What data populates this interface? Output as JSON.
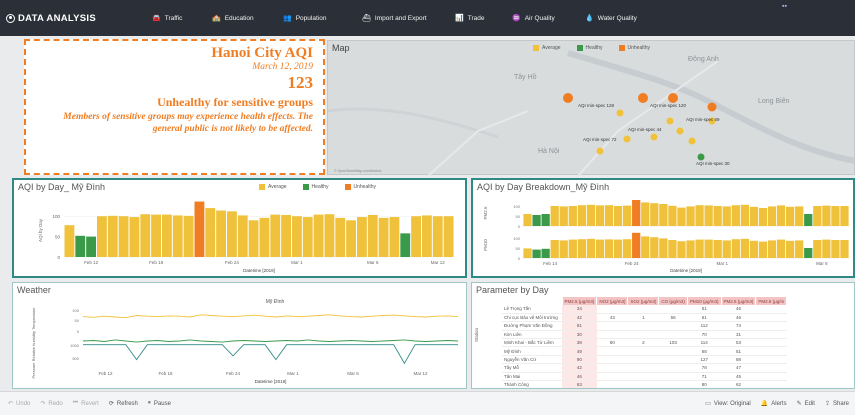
{
  "brand": "DATA ANALYSIS",
  "nav": [
    {
      "label": "Traffic",
      "icon": "car-icon",
      "glyph": "🚘"
    },
    {
      "label": "Education",
      "icon": "school-icon",
      "glyph": "🏫"
    },
    {
      "label": "Population",
      "icon": "people-icon",
      "glyph": "👥"
    },
    {
      "label": "Import and Export",
      "icon": "ship-icon",
      "glyph": "⛴"
    },
    {
      "label": "Trade",
      "icon": "chart-icon",
      "glyph": "📊"
    },
    {
      "label": "Air Quality",
      "icon": "air-icon",
      "glyph": "♒"
    },
    {
      "label": "Water Quality",
      "icon": "water-icon",
      "glyph": "💧"
    }
  ],
  "top_dots": "▪▪",
  "aqi": {
    "city": "Hanoi City AQI",
    "date": "March 12, 2019",
    "value": "123",
    "category": "Unhealthy for sensitive groups",
    "description": "Members of sensitive groups may experience health effects. The general public is not likely to be affected."
  },
  "legend": {
    "average": "Average",
    "healthy": "Healthy",
    "unhealthy": "Unhealthy"
  },
  "colors": {
    "average": "#f0c23b",
    "healthy": "#3a9a4a",
    "unhealthy": "#f07d22",
    "teal": "#2f8a86"
  },
  "map": {
    "title": "Map",
    "places": [
      "Tây Hồ",
      "Long Biên",
      "Đông Anh",
      "Hà Nội"
    ],
    "labels": [
      "AQI min-spec 128",
      "AQI min-spec 120",
      "AQI min-spec 44",
      "AQI min-spec 69",
      "AQI min-spec 72",
      "AQI min-spec 30"
    ],
    "credit": "© OpenStreetMap contributors"
  },
  "aqi_by_day": {
    "title": "AQI by Day",
    "station": "Mỹ Đình",
    "ylabel": "AQI by Day",
    "xlabel": "Datetime [2019]",
    "yticks": [
      "100",
      "50",
      "0"
    ],
    "xticks": [
      "Feb 12",
      "Feb 18",
      "Feb 24",
      "Mar 1",
      "Mar 6",
      "Mar 12"
    ]
  },
  "breakdown": {
    "title": "AQI by Day Breakdown",
    "station": "Mỹ Đình",
    "rows": [
      "PM2.5",
      "PM10"
    ],
    "yticks": [
      "100",
      "50",
      "0"
    ],
    "xticks": [
      "Feb 14",
      "Feb 24",
      "Mar 1",
      "Mar 8"
    ],
    "xlabel": "Datetime [2019]"
  },
  "weather": {
    "title": "Weather",
    "station": "Mỹ Đình",
    "ylabel": "Pressure Relative humidity Temperature",
    "yticks": [
      "100",
      "50",
      "0",
      "1000",
      "500"
    ],
    "xticks": [
      "Feb 12",
      "Feb 18",
      "Feb 24",
      "Mar 1",
      "Mar 6",
      "Mar 12"
    ],
    "xlabel": "Datetime [2019]"
  },
  "param": {
    "title": "Parameter by Day",
    "headers": [
      "PM2.5 (μg/m3)",
      "NO2 (μg/m3)",
      "SO2 (μg/m3)",
      "CO (μg/m3)",
      "PM10 (μg/m3)",
      "PM2.5 (μg/m3)",
      "PM2.5 (μg/m"
    ],
    "rows": [
      {
        "name": "Lê Trọng Tấn",
        "vals": [
          "34",
          "",
          "",
          "",
          "51",
          "46",
          ""
        ]
      },
      {
        "name": "Chi cục Bảo vệ Môi trường",
        "vals": [
          "42",
          "43",
          "1",
          "56",
          "61",
          "46",
          ""
        ]
      },
      {
        "name": "Đường Phạm Văn Đồng",
        "vals": [
          "81",
          "",
          "",
          "",
          "112",
          "74",
          ""
        ]
      },
      {
        "name": "Kim Liên",
        "vals": [
          "30",
          "",
          "",
          "",
          "70",
          "31",
          ""
        ]
      },
      {
        "name": "Minh Khai - Bắc Từ Liêm",
        "vals": [
          "38",
          "80",
          "2",
          "103",
          "114",
          "53",
          ""
        ]
      },
      {
        "name": "Mỹ Đình",
        "vals": [
          "49",
          "",
          "",
          "",
          "68",
          "51",
          ""
        ]
      },
      {
        "name": "Nguyễn Văn Cừ",
        "vals": [
          "90",
          "",
          "",
          "",
          "127",
          "88",
          ""
        ]
      },
      {
        "name": "Tây Mỗ",
        "vals": [
          "42",
          "",
          "",
          "",
          "78",
          "47",
          ""
        ]
      },
      {
        "name": "Tân Mai",
        "vals": [
          "46",
          "",
          "",
          "",
          "71",
          "45",
          ""
        ]
      },
      {
        "name": "Thành Công",
        "vals": [
          "63",
          "",
          "",
          "",
          "80",
          "62",
          ""
        ]
      }
    ],
    "row_label": "Station"
  },
  "bottombar": {
    "left": [
      {
        "label": "Undo",
        "icon": "undo-icon",
        "glyph": "↶",
        "dim": true
      },
      {
        "label": "Redo",
        "icon": "redo-icon",
        "glyph": "↷",
        "dim": true
      },
      {
        "label": "Revert",
        "icon": "revert-icon",
        "glyph": "⏮",
        "dim": true
      },
      {
        "label": "Refresh",
        "icon": "refresh-icon",
        "glyph": "⟳",
        "dim": false
      },
      {
        "label": "Pause",
        "icon": "pause-icon",
        "glyph": "⏸",
        "dim": false
      }
    ],
    "right": [
      {
        "label": "View: Original",
        "icon": "view-icon",
        "glyph": "▭"
      },
      {
        "label": "Alerts",
        "icon": "alert-icon",
        "glyph": "🔔"
      },
      {
        "label": "Edit",
        "icon": "edit-icon",
        "glyph": "✎"
      },
      {
        "label": "Share",
        "icon": "share-icon",
        "glyph": "⇪"
      }
    ]
  },
  "chart_data": [
    {
      "type": "bar",
      "title": "AQI by Day_ Mỹ Đình",
      "xlabel": "Datetime [2019]",
      "ylabel": "AQI by Day",
      "ylim": [
        0,
        130
      ],
      "values": [
        78,
        52,
        50,
        100,
        101,
        100,
        98,
        105,
        104,
        104,
        102,
        101,
        136,
        120,
        114,
        112,
        102,
        90,
        96,
        104,
        103,
        100,
        98,
        104,
        105,
        96,
        90,
        98,
        103,
        96,
        98,
        58,
        100,
        102,
        100,
        100
      ],
      "categories_status": [
        "avg",
        "healthy",
        "healthy",
        "avg",
        "avg",
        "avg",
        "avg",
        "avg",
        "avg",
        "avg",
        "avg",
        "avg",
        "unhealthy",
        "avg",
        "avg",
        "avg",
        "avg",
        "avg",
        "avg",
        "avg",
        "avg",
        "avg",
        "avg",
        "avg",
        "avg",
        "avg",
        "avg",
        "avg",
        "avg",
        "avg",
        "avg",
        "healthy",
        "avg",
        "avg",
        "avg",
        "avg"
      ],
      "legend": [
        "Average",
        "Healthy",
        "Unhealthy"
      ]
    },
    {
      "type": "bar",
      "title": "AQI by Day Breakdown_Mỹ Đình",
      "xlabel": "Datetime [2019]",
      "ylim": [
        0,
        130
      ],
      "series": [
        {
          "name": "PM2.5",
          "values": [
            60,
            55,
            60,
            100,
            98,
            100,
            104,
            106,
            103,
            104,
            100,
            102,
            130,
            118,
            114,
            110,
            101,
            92,
            98,
            104,
            103,
            100,
            98,
            104,
            106,
            96,
            90,
            98,
            103,
            96,
            98,
            60,
            100,
            102,
            100,
            100
          ]
        },
        {
          "name": "PM10",
          "values": [
            48,
            42,
            46,
            90,
            88,
            92,
            94,
            96,
            92,
            93,
            92,
            94,
            126,
            108,
            104,
            98,
            90,
            84,
            88,
            92,
            92,
            90,
            88,
            94,
            96,
            86,
            82,
            88,
            92,
            86,
            88,
            50,
            90,
            92,
            90,
            90
          ]
        }
      ]
    },
    {
      "type": "line",
      "title": "Weather",
      "xlabel": "Datetime [2019]",
      "series": [
        {
          "name": "Temperature",
          "values": [
            78,
            74,
            80,
            76,
            72,
            84,
            80,
            78,
            82,
            80,
            76,
            88,
            84,
            80,
            78,
            82,
            86,
            80,
            76,
            82,
            78,
            80,
            84,
            88,
            82,
            78,
            76,
            80,
            84,
            86,
            82,
            78,
            76,
            80,
            82,
            78
          ]
        },
        {
          "name": "Relative humidity",
          "values": [
            30,
            32,
            28,
            34,
            30,
            26,
            30,
            32,
            28,
            30,
            34,
            30,
            28,
            26,
            30,
            32,
            30,
            28,
            30,
            32,
            30,
            34,
            30,
            28,
            30,
            32,
            30,
            28,
            30,
            32,
            34,
            30,
            28,
            30,
            32,
            30
          ]
        },
        {
          "name": "Pressure",
          "values": [
            1000,
            1000,
            1000,
            1000,
            1000,
            600,
            1000,
            1000,
            1000,
            1000,
            1000,
            1000,
            1000,
            1000,
            700,
            1000,
            1000,
            1000,
            600,
            1000,
            1000,
            1000,
            1000,
            1000,
            1000,
            1000,
            1000,
            1000,
            1000,
            1000,
            500,
            1000,
            1000,
            1000,
            1000,
            1000
          ]
        }
      ]
    }
  ]
}
